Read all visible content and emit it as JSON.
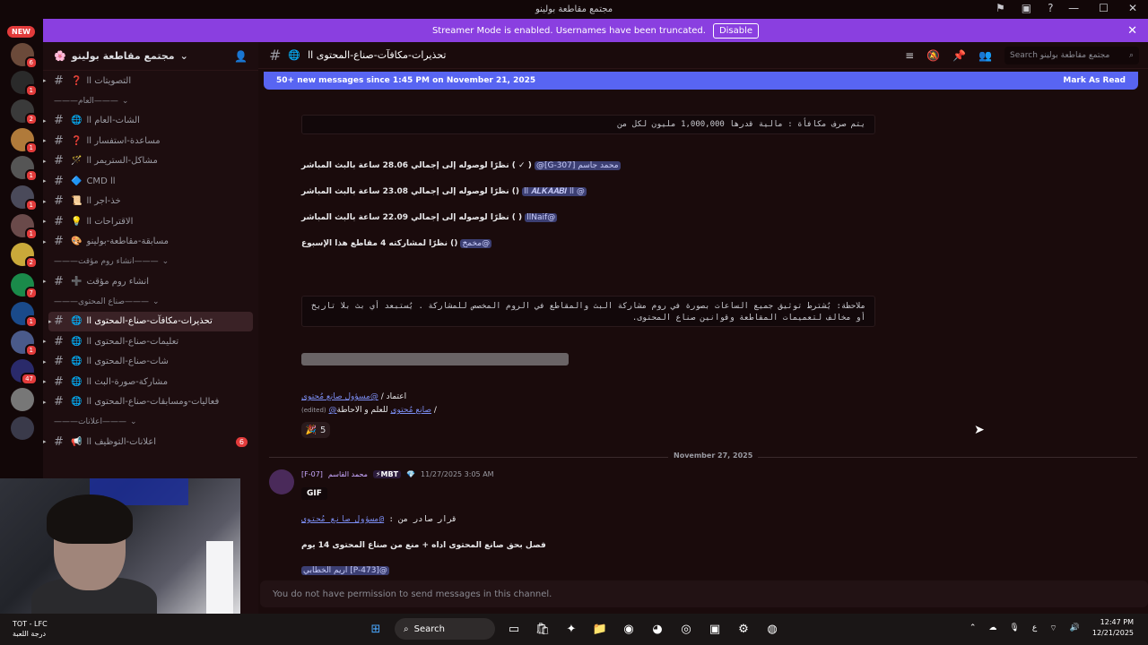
{
  "window": {
    "title": "مجتمع مقاطعة بولينو"
  },
  "banner": {
    "text": "Streamer Mode is enabled. Usernames have been truncated.",
    "disable_label": "Disable"
  },
  "servers": {
    "new_label": "NEW",
    "badges": [
      "6",
      "1",
      "2",
      "1",
      "1",
      "1",
      "1",
      "2",
      "7",
      "1",
      "1",
      "47"
    ]
  },
  "guild": {
    "name": "مجتمع مقاطعة بولينو"
  },
  "channels": {
    "items": [
      {
        "emoji": "❓",
        "label": "التصويتات اا"
      },
      {
        "cat": "العام"
      },
      {
        "emoji": "🌐",
        "label": "الشات-العام اا"
      },
      {
        "emoji": "❓",
        "label": "مساعدة-استفسار اا"
      },
      {
        "emoji": "🪄",
        "label": "مشاكل-الستريمر اا"
      },
      {
        "emoji": "🔷",
        "label": "CMD اا"
      },
      {
        "emoji": "📜",
        "label": "خذ-اجر اا"
      },
      {
        "emoji": "💡",
        "label": "الاقتراحات اا"
      },
      {
        "emoji": "🎨",
        "label": "مسابقة-مقاطعة-بولينو"
      },
      {
        "cat": "انشاء روم مؤقت"
      },
      {
        "emoji": "➕",
        "label": "انشاء روم مؤقت"
      },
      {
        "cat": "صناع المحتوى"
      },
      {
        "emoji": "🌐",
        "label": "تحذيرات-مكافآت-صناع-المحتوى اا",
        "active": true
      },
      {
        "emoji": "🌐",
        "label": "تعليمات-صناع-المحتوى اا"
      },
      {
        "emoji": "🌐",
        "label": "شات-صناع-المحتوى اا"
      },
      {
        "emoji": "🌐",
        "label": "مشاركة-صورة-البث اا"
      },
      {
        "emoji": "🌐",
        "label": "فعاليات-ومسابقات-صناع-المحتوى اا"
      },
      {
        "cat": "اعلانات"
      },
      {
        "emoji": "📢",
        "label": "اعلانات-التوظيف اا",
        "badge": "6"
      }
    ]
  },
  "header": {
    "channel_name": "تحذيرات-مكافآت-صناع-المحتوى اا",
    "search_placeholder": "Search مجتمع مقاطعة بولينو"
  },
  "new_messages": {
    "text": "50+ new messages since 1:45 PM on November 21, 2025",
    "mark_read": "Mark As Read"
  },
  "messages": {
    "code1": "يتم صرف مكافأة : مالية قدرها 1,000,000 مليون لكل من",
    "line1": {
      "mention": "محمد جاسم [G-307]@",
      "text": "( ✓ ) نظرًا لوصوله إلى إجمالي 28.06 ساعة بالبث المباشر"
    },
    "line2": {
      "mention": "@ اا 𝑨𝑳𝑲𝑨𝑨𝑩𝑰 اا",
      "text": "() نظرًا لوصوله إلى إجمالي 23.08 ساعة بالبث المباشر"
    },
    "line3": {
      "mention": "@llNaif",
      "text": "( ) نظرًا لوصوله إلى إجمالي 22.09 ساعة بالبث المباشر"
    },
    "line4": {
      "mention": "@مخمخ",
      "text": "() نظرًا لمشاركته 4 مقاطع هذا الإسبوع"
    },
    "code2": "ملاحظة: يُشترط توثيق جميع الساعات بصورة في روم مشاركة البث والمقاطع في الروم المخصص للمشاركة . يُستبعد أي بث بلا تاريخ أو مخالف لتعميمات المقاطعة وقوانين صناع المحتوى.",
    "approve_label": "اعتماد /",
    "approve_mention": "@مسؤول صانع مُحتوى",
    "info_label": "للعلم و الاحاطة /",
    "info_mention": "@صانع مُحتوى",
    "edited": "(edited)",
    "reaction_count": "5",
    "divider_date": "November 27, 2025",
    "author_id": "[F-07]",
    "author_name": "محمد القاسم",
    "author_tag": "⚡MBT",
    "timestamp": "11/27/2025 3:05 AM",
    "gif_label": "GIF",
    "decision_label": "قرار صادر من :",
    "decision_mention": "@مسؤول صانع مُحتوى",
    "decision_text": "فصل بحق صانع المحتوى اداه + منع من صناع المحتوى 14 يوم",
    "last_line": "@[P-473] اريم الخطابي"
  },
  "composer": {
    "text": "You do not have permission to send messages in this channel."
  },
  "taskbar": {
    "weather_team": "TOT - LFC",
    "weather_sub": "درجة اللعبة",
    "search_label": "Search",
    "lang": "ع",
    "time": "12:47 PM",
    "date": "12/21/2025"
  }
}
